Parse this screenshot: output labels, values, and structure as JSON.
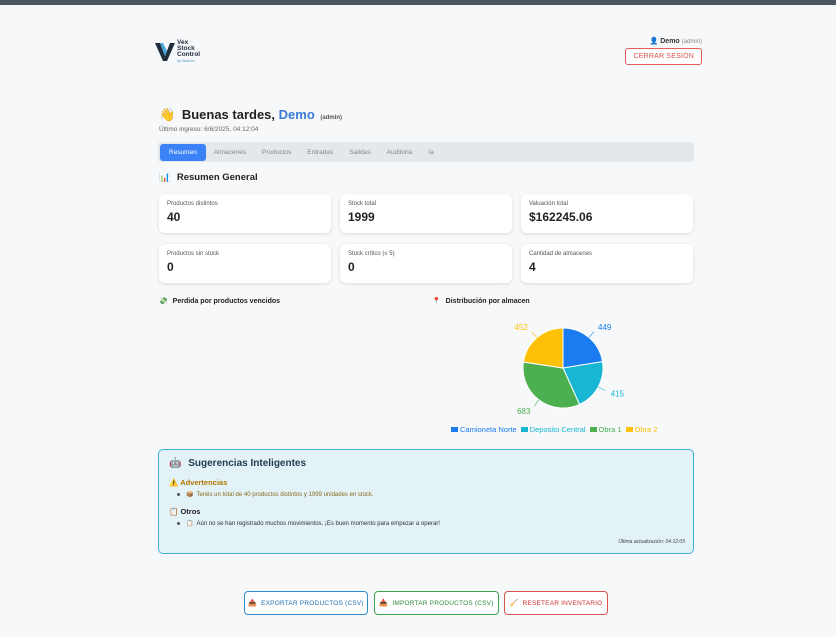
{
  "brand": {
    "line1": "Vex",
    "line2": "Stock",
    "line3": "Control",
    "sub": "by Vexa Inc",
    "color": "#1f2d3d",
    "accent": "#4aa8d8"
  },
  "user": {
    "icon": "user-icon",
    "name": "Demo",
    "role": "(admin)",
    "logout_label": "CERRAR SESIÓN"
  },
  "greeting": {
    "hand_icon": "👋",
    "prefix": "Buenas tardes,",
    "name": "Demo",
    "role": "(admin)",
    "last_login": "Último ingreso: 6/6/2025, 04:12:04"
  },
  "tabs": [
    "Resumen",
    "Almacenes",
    "Productos",
    "Entradas",
    "Salidas",
    "Auditoria",
    "Ia"
  ],
  "active_tab": "Resumen",
  "summary": {
    "icon": "📊",
    "title": "Resumen General",
    "cards": [
      {
        "label": "Productos distintos",
        "value": "40"
      },
      {
        "label": "Stock total",
        "value": "1999"
      },
      {
        "label": "Valuación total",
        "value": "$162245.06"
      },
      {
        "label": "Productos sin stock",
        "value": "0"
      },
      {
        "label": "Stock crítico (≤ 5)",
        "value": "0"
      },
      {
        "label": "Cantidad de almacenes",
        "value": "4"
      }
    ]
  },
  "loss_section": {
    "icon": "💸",
    "title": "Perdida por productos vencidos"
  },
  "distribution_section": {
    "icon": "📍",
    "title": "Distribución por almacen"
  },
  "chart_data": {
    "type": "pie",
    "categories": [
      "Camioneta Norte",
      "Deposito Central",
      "Obra 1",
      "Obra 2"
    ],
    "values": [
      449,
      415,
      683,
      452
    ],
    "colors": [
      "#1a7cf0",
      "#18b6d3",
      "#4caf50",
      "#ffc107"
    ],
    "legend": "bottom"
  },
  "suggestions": {
    "icon": "🤖",
    "title": "Sugerencias Inteligentes",
    "warnings_icon": "⚠️",
    "warnings_title": "Advertencias",
    "warnings": [
      {
        "icon": "📦",
        "text": "Tenés un total de 40 productos distintos y 1999 unidades en stock."
      }
    ],
    "others_icon": "📋",
    "others_title": "Otros",
    "others": [
      {
        "icon": "📋",
        "text": "Aún no se han registrado muchos movimientos. ¡Es buen momento para empezar a operar!"
      }
    ],
    "updated": "Última actualización: 04:12:05"
  },
  "actions": {
    "export": {
      "icon": "📤",
      "label": "EXPORTAR PRODUCTOS (CSV)"
    },
    "import": {
      "icon": "📥",
      "label": "IMPORTAR PRODUCTOS (CSV)"
    },
    "reset": {
      "icon": "🧹",
      "label": "RESETEAR INVENTARIO"
    }
  }
}
